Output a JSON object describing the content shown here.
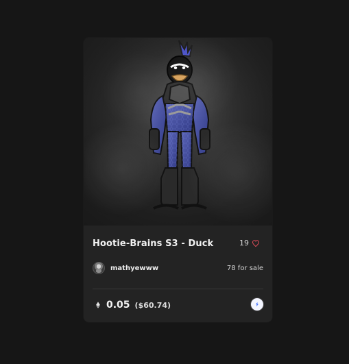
{
  "card": {
    "title": "Hootie-Brains S3 - Duck",
    "likes": "19",
    "owner": "mathyewww",
    "sale": "78 for sale",
    "price_eth": "0.05",
    "price_usd": "($60.74)"
  },
  "icons": {
    "heart": "heart-icon",
    "avatar": "avatar",
    "ethereum": "ethereum-icon",
    "chain": "chain-icon"
  },
  "colors": {
    "page_bg": "#161616",
    "card_bg": "#232323",
    "text": "#f2f2f2",
    "muted_text": "#d6d6d6",
    "divider": "#3a3a3a",
    "heart": "#e24d5a",
    "chain_bg": "#f3f5ff",
    "chain_accent": "#3b6cff"
  }
}
